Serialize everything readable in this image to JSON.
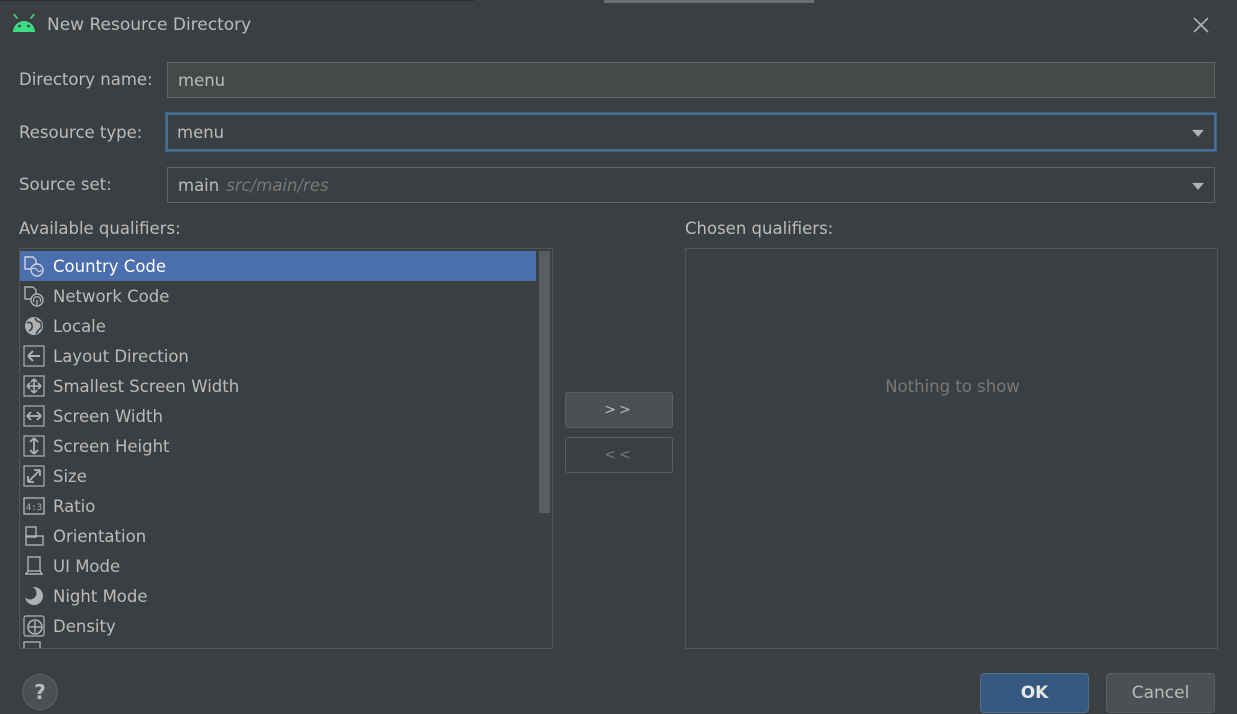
{
  "window": {
    "title": "New Resource Directory",
    "accent_color": "#3ddc84"
  },
  "form": {
    "directory_name_label": "Directory name:",
    "directory_name_value": "menu",
    "resource_type_label": "Resource type:",
    "resource_type_value": "menu",
    "source_set_label": "Source set:",
    "source_set_value": "main",
    "source_set_path": "src/main/res"
  },
  "available": {
    "label": "Available qualifiers:",
    "items": [
      {
        "label": "Country Code",
        "icon": "country-code-icon",
        "selected": true
      },
      {
        "label": "Network Code",
        "icon": "network-code-icon"
      },
      {
        "label": "Locale",
        "icon": "globe-icon"
      },
      {
        "label": "Layout Direction",
        "icon": "arrow-left-icon"
      },
      {
        "label": "Smallest Screen Width",
        "icon": "move-arrows-icon"
      },
      {
        "label": "Screen Width",
        "icon": "horizontal-arrows-icon"
      },
      {
        "label": "Screen Height",
        "icon": "vertical-arrows-icon"
      },
      {
        "label": "Size",
        "icon": "diagonal-resize-icon"
      },
      {
        "label": "Ratio",
        "icon": "ratio-icon"
      },
      {
        "label": "Orientation",
        "icon": "orientation-icon"
      },
      {
        "label": "UI Mode",
        "icon": "ui-mode-icon"
      },
      {
        "label": "Night Mode",
        "icon": "moon-icon"
      },
      {
        "label": "Density",
        "icon": "density-icon"
      }
    ]
  },
  "chosen": {
    "label": "Chosen qualifiers:",
    "empty_text": "Nothing to show"
  },
  "buttons": {
    "add": ">>",
    "remove": "<<",
    "help": "?",
    "ok": "OK",
    "cancel": "Cancel"
  },
  "colors": {
    "background": "#3c3f41",
    "selection": "#4b6eaf",
    "focus_border": "#466d94",
    "ok_button": "#365880"
  }
}
